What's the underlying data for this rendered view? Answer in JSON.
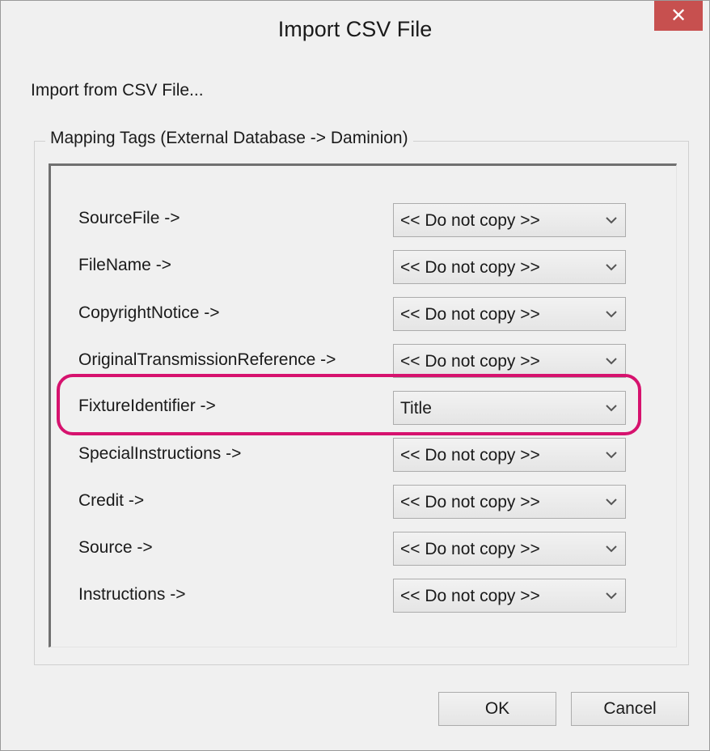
{
  "window": {
    "title": "Import CSV File",
    "close_glyph": "✕"
  },
  "import_label": "Import from CSV File...",
  "group": {
    "caption": "Mapping Tags (External Database -> Daminion)"
  },
  "mappings": [
    {
      "label": "SourceFile ->",
      "value": "<< Do not copy >>"
    },
    {
      "label": "FileName ->",
      "value": "<< Do not copy >>"
    },
    {
      "label": "CopyrightNotice ->",
      "value": "<< Do not copy >>"
    },
    {
      "label": "OriginalTransmissionReference ->",
      "value": "<< Do not copy >>"
    },
    {
      "label": "FixtureIdentifier ->",
      "value": "Title"
    },
    {
      "label": "SpecialInstructions ->",
      "value": "<< Do not copy >>"
    },
    {
      "label": "Credit ->",
      "value": "<< Do not copy >>"
    },
    {
      "label": "Source ->",
      "value": "<< Do not copy >>"
    },
    {
      "label": "Instructions ->",
      "value": "<< Do not copy >>"
    }
  ],
  "buttons": {
    "ok": "OK",
    "cancel": "Cancel"
  },
  "colors": {
    "close_button": "#c7504f",
    "highlight": "#d6126e"
  },
  "icons": {
    "close": "close-icon",
    "dropdown": "chevron-down-icon"
  }
}
